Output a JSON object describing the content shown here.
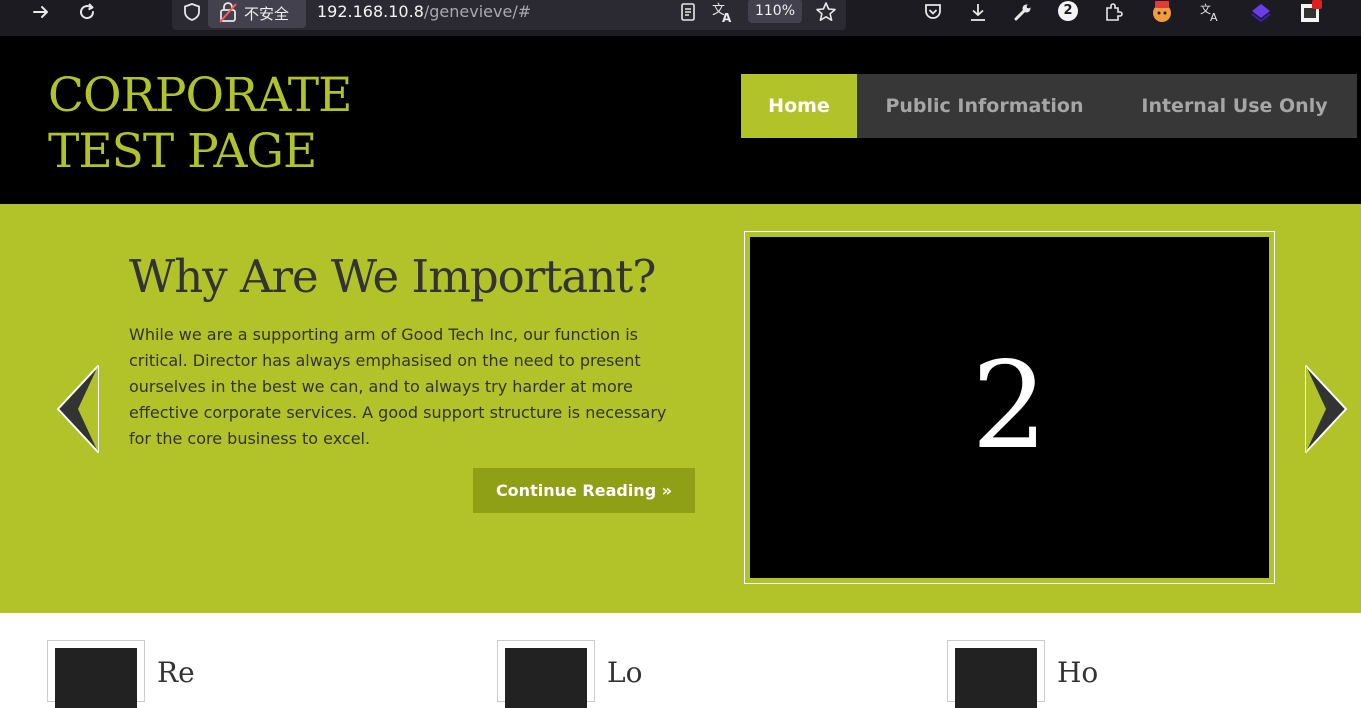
{
  "browser": {
    "security_label": "不安全",
    "url_host": "192.168.10.8",
    "url_path": "/genevieve/#",
    "zoom": "110%",
    "extension_badge": "2",
    "icons": [
      "forward-icon",
      "reload-icon",
      "shield-icon",
      "insecure-lock-icon",
      "reader-view-icon",
      "translate-icon",
      "bookmark-star-icon",
      "pocket-icon",
      "download-icon",
      "wrench-icon",
      "extensions-icon",
      "translate-ext-icon"
    ]
  },
  "site": {
    "title_line1": "CORPORATE",
    "title_line2": "TEST PAGE",
    "nav": {
      "home": "Home",
      "public": "Public Information",
      "internal": "Internal Use Only",
      "active": "home"
    }
  },
  "slider": {
    "heading": "Why Are We Important?",
    "body": "While we are a supporting arm of Good Tech Inc, our function is critical. Director has always emphasised on the need to present ourselves in the best we can, and to always try harder at more effective corporate services. A good support structure is necessary for the core business to excel.",
    "button": "Continue Reading »",
    "slide_number": "2"
  },
  "features": [
    {
      "title": "Re"
    },
    {
      "title": "Lo"
    },
    {
      "title": "Ho"
    }
  ],
  "colors": {
    "accent": "#b2c329",
    "header_bg": "#000000",
    "nav_bg": "#373737",
    "button_bg": "#8fa017",
    "text_dark": "#333333",
    "toolbar_bg": "#1c1b22"
  }
}
